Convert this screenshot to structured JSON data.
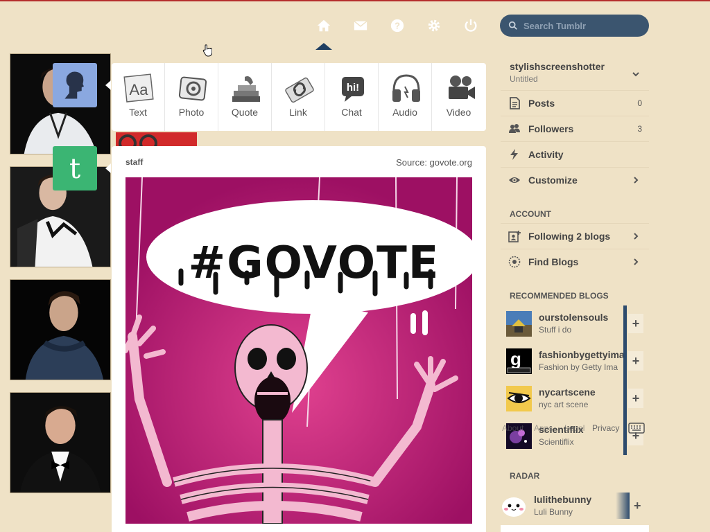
{
  "header": {
    "nav": [
      "home-icon",
      "mail-icon",
      "help-icon",
      "gear-icon",
      "power-icon"
    ],
    "search_placeholder": "Search Tumblr",
    "colors": {
      "nav_icon": "#ffffff",
      "search_bg": "#3b556f",
      "top_line": "#b52d2d"
    }
  },
  "post_types": [
    {
      "label": "Text",
      "icon": "text-icon"
    },
    {
      "label": "Photo",
      "icon": "photo-icon"
    },
    {
      "label": "Quote",
      "icon": "quote-icon"
    },
    {
      "label": "Link",
      "icon": "link-icon"
    },
    {
      "label": "Chat",
      "icon": "chat-icon"
    },
    {
      "label": "Audio",
      "icon": "audio-icon"
    },
    {
      "label": "Video",
      "icon": "video-icon"
    }
  ],
  "post": {
    "author": "staff",
    "source": "Source: govote.org",
    "image_text": "#GOVOTE",
    "image_bg": "#c81f7e"
  },
  "sidebar": {
    "blog_name": "stylishscreenshotter",
    "blog_subtitle": "Untitled",
    "menu": [
      {
        "label": "Posts",
        "count": "0",
        "icon": "posts-icon"
      },
      {
        "label": "Followers",
        "count": "3",
        "icon": "followers-icon"
      },
      {
        "label": "Activity",
        "count": "",
        "icon": "activity-icon"
      },
      {
        "label": "Customize",
        "count": "",
        "icon": "eye-icon"
      }
    ],
    "account_title": "ACCOUNT",
    "account": [
      {
        "label": "Following 2 blogs",
        "icon": "following-icon"
      },
      {
        "label": "Find Blogs",
        "icon": "find-blogs-icon"
      }
    ],
    "recommended_title": "RECOMMENDED BLOGS",
    "recommended": [
      {
        "name": "ourstolensouls",
        "desc": "Stuff i do"
      },
      {
        "name": "fashionbygettyima",
        "desc": "Fashion by Getty Ima"
      },
      {
        "name": "nycartscene",
        "desc": "nyc art scene"
      },
      {
        "name": "scientiflix",
        "desc": "Scientiflix"
      }
    ],
    "footer": [
      "About",
      "Apps",
      "Legal",
      "Privacy"
    ],
    "radar_title": "RADAR",
    "radar": {
      "name": "lulithebunny",
      "desc": "Luli Bunny"
    },
    "colors": {
      "bar": "#2d4b6d"
    }
  }
}
